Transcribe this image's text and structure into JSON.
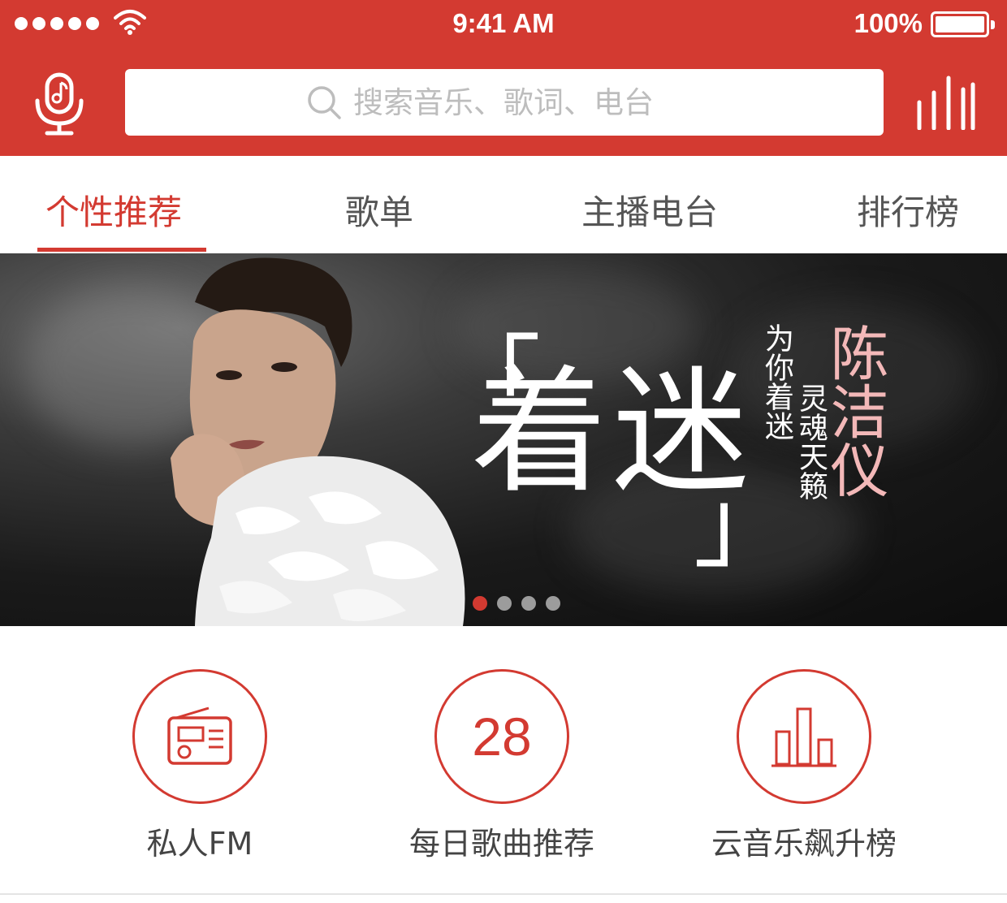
{
  "status_bar": {
    "time": "9:41 AM",
    "battery": "100%"
  },
  "header": {
    "accent_color": "#d33a31",
    "left_icon": "mic-icon",
    "right_icon": "equalizer-icon",
    "search": {
      "placeholder": "搜索音乐、歌词、电台",
      "value": ""
    }
  },
  "tabs": [
    {
      "label": "个性推荐",
      "active": true
    },
    {
      "label": "歌单",
      "active": false
    },
    {
      "label": "主播电台",
      "active": false
    },
    {
      "label": "排行榜",
      "active": false
    }
  ],
  "banner": {
    "open_bracket": "「",
    "title": "着迷",
    "close_bracket": "」",
    "tagline_1": "为你着迷",
    "tagline_2": "灵魂天籁",
    "artist": "陈洁仪",
    "page_count": 4,
    "current_page": 1
  },
  "shortcuts": [
    {
      "icon": "radio-icon",
      "label": "私人FM"
    },
    {
      "icon": "calendar-number",
      "number": "28",
      "label": "每日歌曲推荐"
    },
    {
      "icon": "bar-chart-icon",
      "label": "云音乐飙升榜"
    }
  ]
}
